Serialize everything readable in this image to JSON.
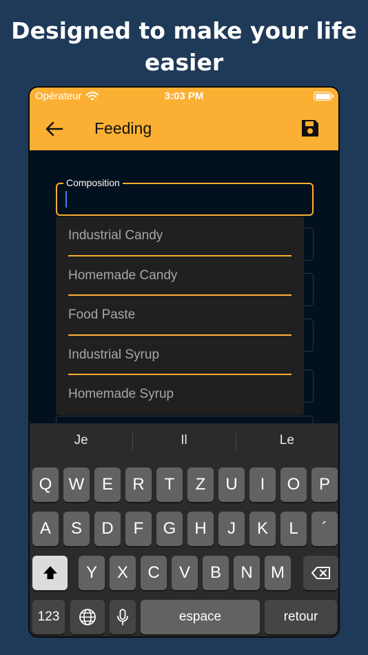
{
  "headline": "Designed to make your life easier",
  "status_bar": {
    "carrier": "Opérateur",
    "time": "3:03 PM",
    "wifi_icon": "wifi-icon",
    "battery_icon": "battery-icon"
  },
  "app_bar": {
    "title": "Feeding",
    "back_icon": "arrow-left-icon",
    "save_icon": "floppy-disk-icon",
    "background": "#fcb033"
  },
  "composition": {
    "label": "Composition",
    "value": "",
    "accent": "#fcb033"
  },
  "dropdown": {
    "options": [
      "Industrial Candy",
      "Homemade Candy",
      "Food Paste",
      "Industrial Syrup",
      "Homemade Syrup"
    ]
  },
  "keyboard": {
    "suggestions": [
      "Je",
      "Il",
      "Le"
    ],
    "row1": [
      "Q",
      "W",
      "E",
      "R",
      "T",
      "Z",
      "U",
      "I",
      "O",
      "P"
    ],
    "row2": [
      "A",
      "S",
      "D",
      "F",
      "G",
      "H",
      "J",
      "K",
      "L",
      "´"
    ],
    "row3": [
      "Y",
      "X",
      "C",
      "V",
      "B",
      "N",
      "M"
    ],
    "numbers_key": "123",
    "space_key": "espace",
    "return_key": "retour",
    "shift_icon": "shift-icon",
    "delete_icon": "backspace-icon",
    "globe_icon": "globe-icon",
    "mic_icon": "microphone-icon"
  }
}
